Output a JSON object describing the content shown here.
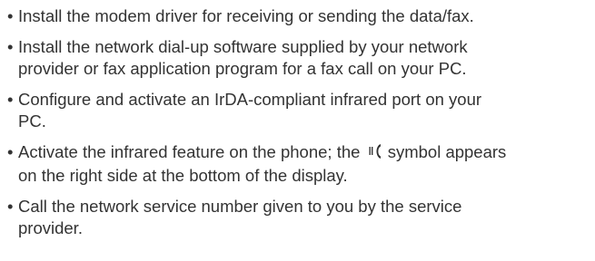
{
  "bullet_char": "•",
  "items": [
    {
      "text": "Install the modem driver for receiving or sending the data/fax."
    },
    {
      "line1": "Install the network dial-up software supplied by your network",
      "line2": "provider or fax application program for a fax call on your PC."
    },
    {
      "line1": "Configure and activate an IrDA-compliant infrared port on your",
      "line2": "PC."
    },
    {
      "before_icon": "Activate the infrared feature on the phone; the ",
      "icon": "infrared-symbol-icon",
      "after_icon": " symbol appears",
      "line2": "on the right side at the bottom of the display."
    },
    {
      "line1": "Call the network service number given to you by the service",
      "line2": "provider."
    }
  ]
}
